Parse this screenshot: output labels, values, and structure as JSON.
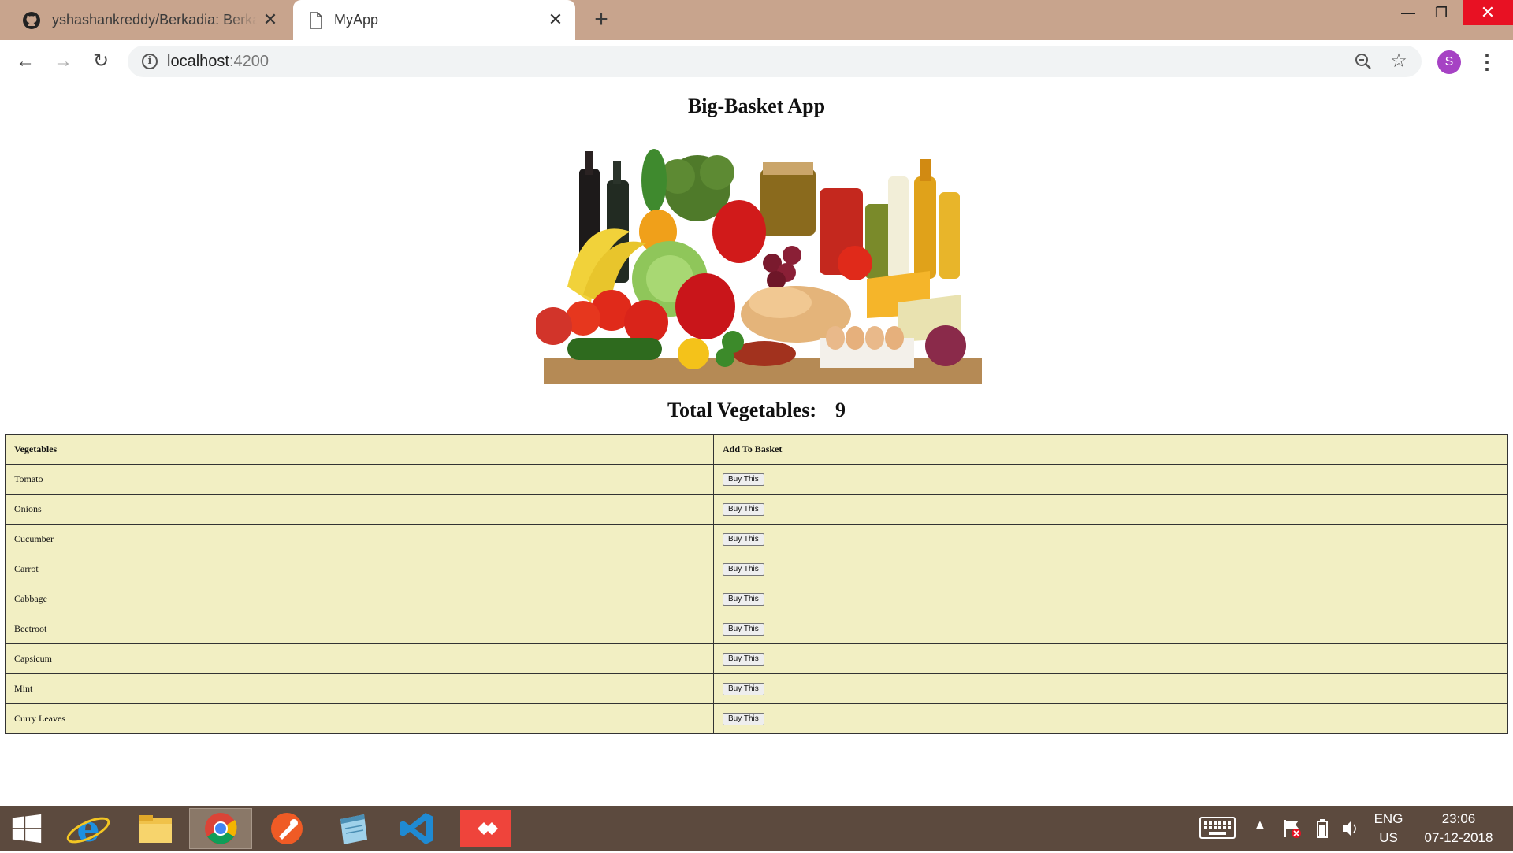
{
  "browser": {
    "tabs": [
      {
        "title": "yshashankreddy/Berkadia: Berkadia",
        "icon": "github-icon",
        "active": false
      },
      {
        "title": "MyApp",
        "icon": "page-icon",
        "active": true
      }
    ],
    "url_host": "localhost",
    "url_port": ":4200",
    "profile_initial": "S",
    "profile_color": "#a642c4"
  },
  "app": {
    "title": "Big-Basket App",
    "total_label": "Total Vegetables:",
    "total_count": "9",
    "table": {
      "headers": [
        "Vegetables",
        "Add To Basket"
      ],
      "buy_label": "Buy This",
      "rows": [
        "Tomato",
        "Onions",
        "Cucumber",
        "Carrot",
        "Cabbage",
        "Beetroot",
        "Capsicum",
        "Mint",
        "Curry Leaves"
      ]
    },
    "table_bg": "#f2efc3"
  },
  "taskbar": {
    "apps": [
      "start-icon",
      "internet-explorer-icon",
      "file-explorer-icon",
      "chrome-icon",
      "postman-icon",
      "notepad-icon",
      "vscode-icon",
      "anydesk-icon"
    ],
    "language": "ENG",
    "region": "US",
    "time": "23:06",
    "date": "07-12-2018"
  }
}
